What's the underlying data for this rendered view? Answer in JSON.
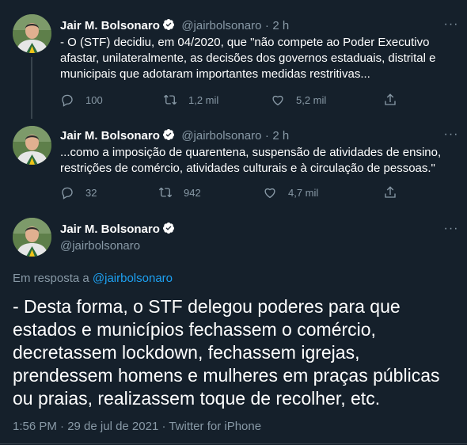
{
  "tweets": [
    {
      "name": "Jair M. Bolsonaro",
      "handle": "@jairbolsonaro",
      "sep": "·",
      "time": "2 h",
      "text": "- O (STF) decidiu, em 04/2020, que \"não compete ao Poder Executivo afastar, unilateralmente, as decisões dos governos estaduais, distrital e municipais que adotaram importantes medidas restritivas...",
      "replies": "100",
      "retweets": "1,2 mil",
      "likes": "5,2 mil"
    },
    {
      "name": "Jair M. Bolsonaro",
      "handle": "@jairbolsonaro",
      "sep": "·",
      "time": "2 h",
      "text": "...como a imposição de quarentena, suspensão de atividades de ensino, restrições de comércio, atividades culturais e à circulação de pessoas.\"",
      "replies": "32",
      "retweets": "942",
      "likes": "4,7 mil"
    }
  ],
  "main": {
    "name": "Jair M. Bolsonaro",
    "handle": "@jairbolsonaro",
    "reply_prefix": "Em resposta a",
    "reply_to": "@jairbolsonaro",
    "text": "- Desta forma, o STF delegou poderes para que estados e municípios fechassem o comércio, decretassem lockdown, fechassem igrejas, prendessem homens e mulheres em praças públicas ou praias, realizassem toque de recolher, etc.",
    "meta": "1:56 PM · 29 de jul de 2021 · Twitter for iPhone"
  },
  "icons": {
    "more": "more-dots-icon",
    "reply": "reply-icon",
    "retweet": "retweet-icon",
    "like": "heart-icon",
    "share": "share-icon",
    "verified": "verified-badge-icon"
  },
  "colors": {
    "background": "#15202b",
    "muted": "#8899a6",
    "link": "#1da1f2",
    "verified": "#ffffff"
  }
}
